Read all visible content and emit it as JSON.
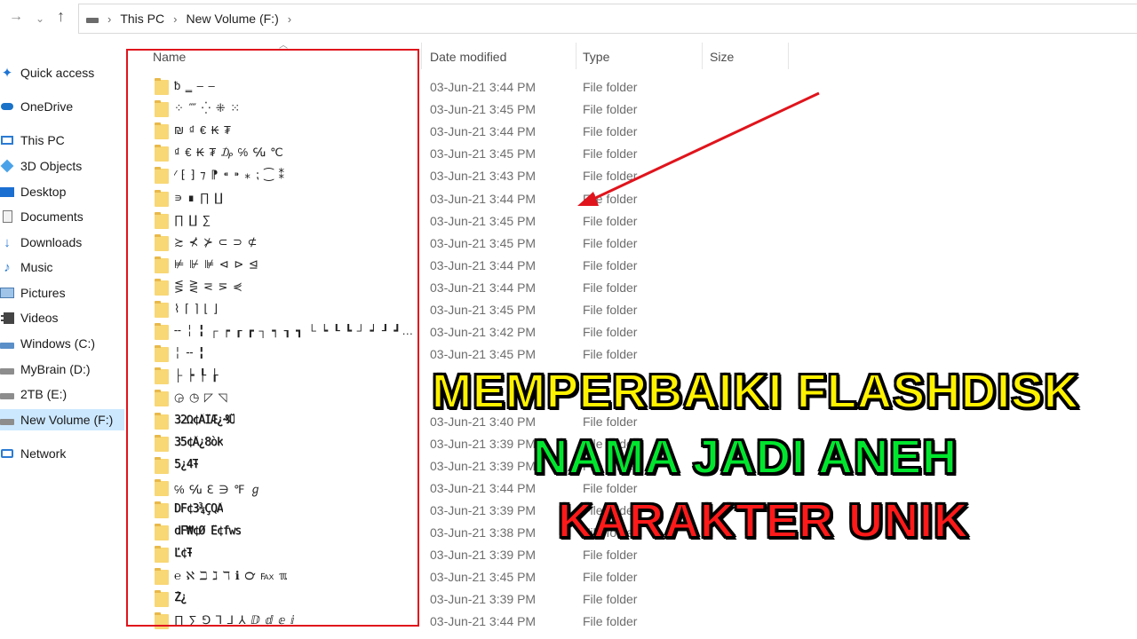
{
  "address": {
    "segments": [
      "This PC",
      "New Volume (F:)"
    ]
  },
  "nav": [
    {
      "label": "Quick access",
      "icon": "star-icon"
    },
    {
      "label": "OneDrive",
      "icon": "cloud-icon"
    },
    {
      "label": "This PC",
      "icon": "computer-icon"
    },
    {
      "label": "3D Objects",
      "icon": "cube-icon"
    },
    {
      "label": "Desktop",
      "icon": "desktop-icon"
    },
    {
      "label": "Documents",
      "icon": "document-icon"
    },
    {
      "label": "Downloads",
      "icon": "download-icon"
    },
    {
      "label": "Music",
      "icon": "music-icon"
    },
    {
      "label": "Pictures",
      "icon": "picture-icon"
    },
    {
      "label": "Videos",
      "icon": "video-icon"
    },
    {
      "label": "Windows (C:)",
      "icon": "drive-icon"
    },
    {
      "label": "MyBrain (D:)",
      "icon": "drive-icon"
    },
    {
      "label": "2TB (E:)",
      "icon": "drive-icon"
    },
    {
      "label": "New Volume (F:)",
      "icon": "drive-icon",
      "selected": true
    },
    {
      "label": "Network",
      "icon": "network-icon"
    }
  ],
  "columns": {
    "name": "Name",
    "date": "Date modified",
    "type": "Type",
    "size": "Size"
  },
  "files": [
    {
      "name": "ƀ ‗ ‒ ‒",
      "date": "03-Jun-21 3:44 PM",
      "type": "File folder"
    },
    {
      "name": "⁘ ⁗ ⁛ ⁜ ⁙",
      "date": "03-Jun-21 3:45 PM",
      "type": "File folder"
    },
    {
      "name": "₪ ₫ € ₭ ₮",
      "date": "03-Jun-21 3:44 PM",
      "type": "File folder"
    },
    {
      "name": "₫ € ₭ ₮ ₯ ℅ ℆ ℃",
      "date": "03-Jun-21 3:45 PM",
      "type": "File folder"
    },
    {
      "name": "⁄ ⁅ ⁆ ⁊ ⁋ ⁌ ⁍ ⁎ ⁏ ⁐ ⁑",
      "date": "03-Jun-21 3:43 PM",
      "type": "File folder"
    },
    {
      "name": "∍ ∎ ∏ ∐",
      "date": "03-Jun-21 3:44 PM",
      "type": "File folder"
    },
    {
      "name": "∏ ∐ ∑",
      "date": "03-Jun-21 3:45 PM",
      "type": "File folder"
    },
    {
      "name": "≿ ⊀ ⊁ ⊂ ⊃ ⊄",
      "date": "03-Jun-21 3:45 PM",
      "type": "File folder"
    },
    {
      "name": "⊭ ⊮ ⊯ ⊲ ⊳ ⊴",
      "date": "03-Jun-21 3:44 PM",
      "type": "File folder"
    },
    {
      "name": "⋚ ⋛ ⋜ ⋝ ⋞",
      "date": "03-Jun-21 3:44 PM",
      "type": "File folder"
    },
    {
      "name": "⌇ ⌈ ⌉ ⌊ ⌋",
      "date": "03-Jun-21 3:45 PM",
      "type": "File folder"
    },
    {
      "name": "╌ ╎ ╏ ┌ ┍ ┎ ┏ ┐ ┑ ┒ ┓ └ ┕ ┖ ┗ ┘ ┙ ┚ ┛ ├ ┝ ┞ ┟ ┠ ┡ ┢ ┣ ┤ ┥ ┦ ┧",
      "date": "03-Jun-21 3:42 PM",
      "type": "File folder"
    },
    {
      "name": "╎ ╌ ╏",
      "date": "03-Jun-21 3:45 PM",
      "type": "File folder"
    },
    {
      "name": "├ ┝ ┞ ┟",
      "date": "",
      "type": ""
    },
    {
      "name": "◶ ◷ ◸ ◹",
      "date": "",
      "type": ""
    },
    {
      "name": "32Ω¢ÄÏÆ¿₰Ů",
      "date": "03-Jun-21 3:40 PM",
      "type": "File folder"
    },
    {
      "name": "35¢Â¿8òk",
      "date": "03-Jun-21 3:39 PM",
      "type": "File folder"
    },
    {
      "name": "5¿4Ŧ",
      "date": "03-Jun-21 3:39 PM",
      "type": "File folder"
    },
    {
      "name": "℅ ℆ ℇ ∋ ℉ ℊ",
      "date": "03-Jun-21 3:44 PM",
      "type": "File folder"
    },
    {
      "name": "DF¢3¾ÇQÃ",
      "date": "03-Jun-21 3:39 PM",
      "type": "File folder"
    },
    {
      "name": "dF₩¢Ø Ë¢fws",
      "date": "03-Jun-21 3:38 PM",
      "type": "File folder"
    },
    {
      "name": "Ľ¢Ŧ",
      "date": "03-Jun-21 3:39 PM",
      "type": "File folder"
    },
    {
      "name": "℮ ℵ ℶ ℷ ℸ ℹ ℺ ℻ ℼ",
      "date": "03-Jun-21 3:45 PM",
      "type": "File folder"
    },
    {
      "name": "Ž¿",
      "date": "03-Jun-21 3:39 PM",
      "type": "File folder"
    },
    {
      "name": "∏ ∑ ⅁ ⅂ ⅃ ⅄ ⅅ ⅆ ⅇ ⅈ",
      "date": "03-Jun-21 3:44 PM",
      "type": "File folder"
    }
  ],
  "caption": {
    "line1": "MEMPERBAIKI FLASHDISK",
    "line2": "NAMA JADI ANEH",
    "line3": "KARAKTER UNIK"
  },
  "colors": {
    "highlight": "#e0141c",
    "caption1": "#fff200",
    "caption2": "#00e62e",
    "caption3": "#ff1a1a"
  }
}
